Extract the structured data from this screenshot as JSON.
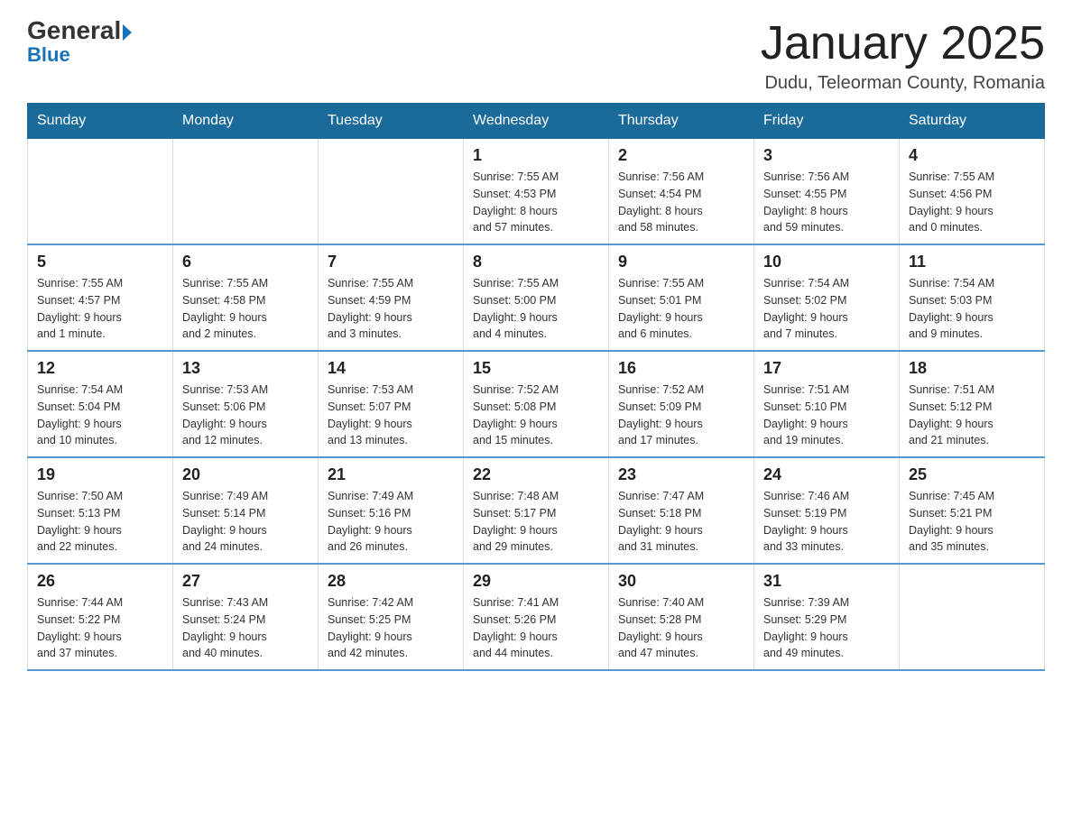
{
  "logo": {
    "general": "General",
    "blue": "Blue"
  },
  "title": {
    "month_year": "January 2025",
    "location": "Dudu, Teleorman County, Romania"
  },
  "days_of_week": [
    "Sunday",
    "Monday",
    "Tuesday",
    "Wednesday",
    "Thursday",
    "Friday",
    "Saturday"
  ],
  "weeks": [
    [
      {
        "day": "",
        "info": ""
      },
      {
        "day": "",
        "info": ""
      },
      {
        "day": "",
        "info": ""
      },
      {
        "day": "1",
        "info": "Sunrise: 7:55 AM\nSunset: 4:53 PM\nDaylight: 8 hours\nand 57 minutes."
      },
      {
        "day": "2",
        "info": "Sunrise: 7:56 AM\nSunset: 4:54 PM\nDaylight: 8 hours\nand 58 minutes."
      },
      {
        "day": "3",
        "info": "Sunrise: 7:56 AM\nSunset: 4:55 PM\nDaylight: 8 hours\nand 59 minutes."
      },
      {
        "day": "4",
        "info": "Sunrise: 7:55 AM\nSunset: 4:56 PM\nDaylight: 9 hours\nand 0 minutes."
      }
    ],
    [
      {
        "day": "5",
        "info": "Sunrise: 7:55 AM\nSunset: 4:57 PM\nDaylight: 9 hours\nand 1 minute."
      },
      {
        "day": "6",
        "info": "Sunrise: 7:55 AM\nSunset: 4:58 PM\nDaylight: 9 hours\nand 2 minutes."
      },
      {
        "day": "7",
        "info": "Sunrise: 7:55 AM\nSunset: 4:59 PM\nDaylight: 9 hours\nand 3 minutes."
      },
      {
        "day": "8",
        "info": "Sunrise: 7:55 AM\nSunset: 5:00 PM\nDaylight: 9 hours\nand 4 minutes."
      },
      {
        "day": "9",
        "info": "Sunrise: 7:55 AM\nSunset: 5:01 PM\nDaylight: 9 hours\nand 6 minutes."
      },
      {
        "day": "10",
        "info": "Sunrise: 7:54 AM\nSunset: 5:02 PM\nDaylight: 9 hours\nand 7 minutes."
      },
      {
        "day": "11",
        "info": "Sunrise: 7:54 AM\nSunset: 5:03 PM\nDaylight: 9 hours\nand 9 minutes."
      }
    ],
    [
      {
        "day": "12",
        "info": "Sunrise: 7:54 AM\nSunset: 5:04 PM\nDaylight: 9 hours\nand 10 minutes."
      },
      {
        "day": "13",
        "info": "Sunrise: 7:53 AM\nSunset: 5:06 PM\nDaylight: 9 hours\nand 12 minutes."
      },
      {
        "day": "14",
        "info": "Sunrise: 7:53 AM\nSunset: 5:07 PM\nDaylight: 9 hours\nand 13 minutes."
      },
      {
        "day": "15",
        "info": "Sunrise: 7:52 AM\nSunset: 5:08 PM\nDaylight: 9 hours\nand 15 minutes."
      },
      {
        "day": "16",
        "info": "Sunrise: 7:52 AM\nSunset: 5:09 PM\nDaylight: 9 hours\nand 17 minutes."
      },
      {
        "day": "17",
        "info": "Sunrise: 7:51 AM\nSunset: 5:10 PM\nDaylight: 9 hours\nand 19 minutes."
      },
      {
        "day": "18",
        "info": "Sunrise: 7:51 AM\nSunset: 5:12 PM\nDaylight: 9 hours\nand 21 minutes."
      }
    ],
    [
      {
        "day": "19",
        "info": "Sunrise: 7:50 AM\nSunset: 5:13 PM\nDaylight: 9 hours\nand 22 minutes."
      },
      {
        "day": "20",
        "info": "Sunrise: 7:49 AM\nSunset: 5:14 PM\nDaylight: 9 hours\nand 24 minutes."
      },
      {
        "day": "21",
        "info": "Sunrise: 7:49 AM\nSunset: 5:16 PM\nDaylight: 9 hours\nand 26 minutes."
      },
      {
        "day": "22",
        "info": "Sunrise: 7:48 AM\nSunset: 5:17 PM\nDaylight: 9 hours\nand 29 minutes."
      },
      {
        "day": "23",
        "info": "Sunrise: 7:47 AM\nSunset: 5:18 PM\nDaylight: 9 hours\nand 31 minutes."
      },
      {
        "day": "24",
        "info": "Sunrise: 7:46 AM\nSunset: 5:19 PM\nDaylight: 9 hours\nand 33 minutes."
      },
      {
        "day": "25",
        "info": "Sunrise: 7:45 AM\nSunset: 5:21 PM\nDaylight: 9 hours\nand 35 minutes."
      }
    ],
    [
      {
        "day": "26",
        "info": "Sunrise: 7:44 AM\nSunset: 5:22 PM\nDaylight: 9 hours\nand 37 minutes."
      },
      {
        "day": "27",
        "info": "Sunrise: 7:43 AM\nSunset: 5:24 PM\nDaylight: 9 hours\nand 40 minutes."
      },
      {
        "day": "28",
        "info": "Sunrise: 7:42 AM\nSunset: 5:25 PM\nDaylight: 9 hours\nand 42 minutes."
      },
      {
        "day": "29",
        "info": "Sunrise: 7:41 AM\nSunset: 5:26 PM\nDaylight: 9 hours\nand 44 minutes."
      },
      {
        "day": "30",
        "info": "Sunrise: 7:40 AM\nSunset: 5:28 PM\nDaylight: 9 hours\nand 47 minutes."
      },
      {
        "day": "31",
        "info": "Sunrise: 7:39 AM\nSunset: 5:29 PM\nDaylight: 9 hours\nand 49 minutes."
      },
      {
        "day": "",
        "info": ""
      }
    ]
  ]
}
